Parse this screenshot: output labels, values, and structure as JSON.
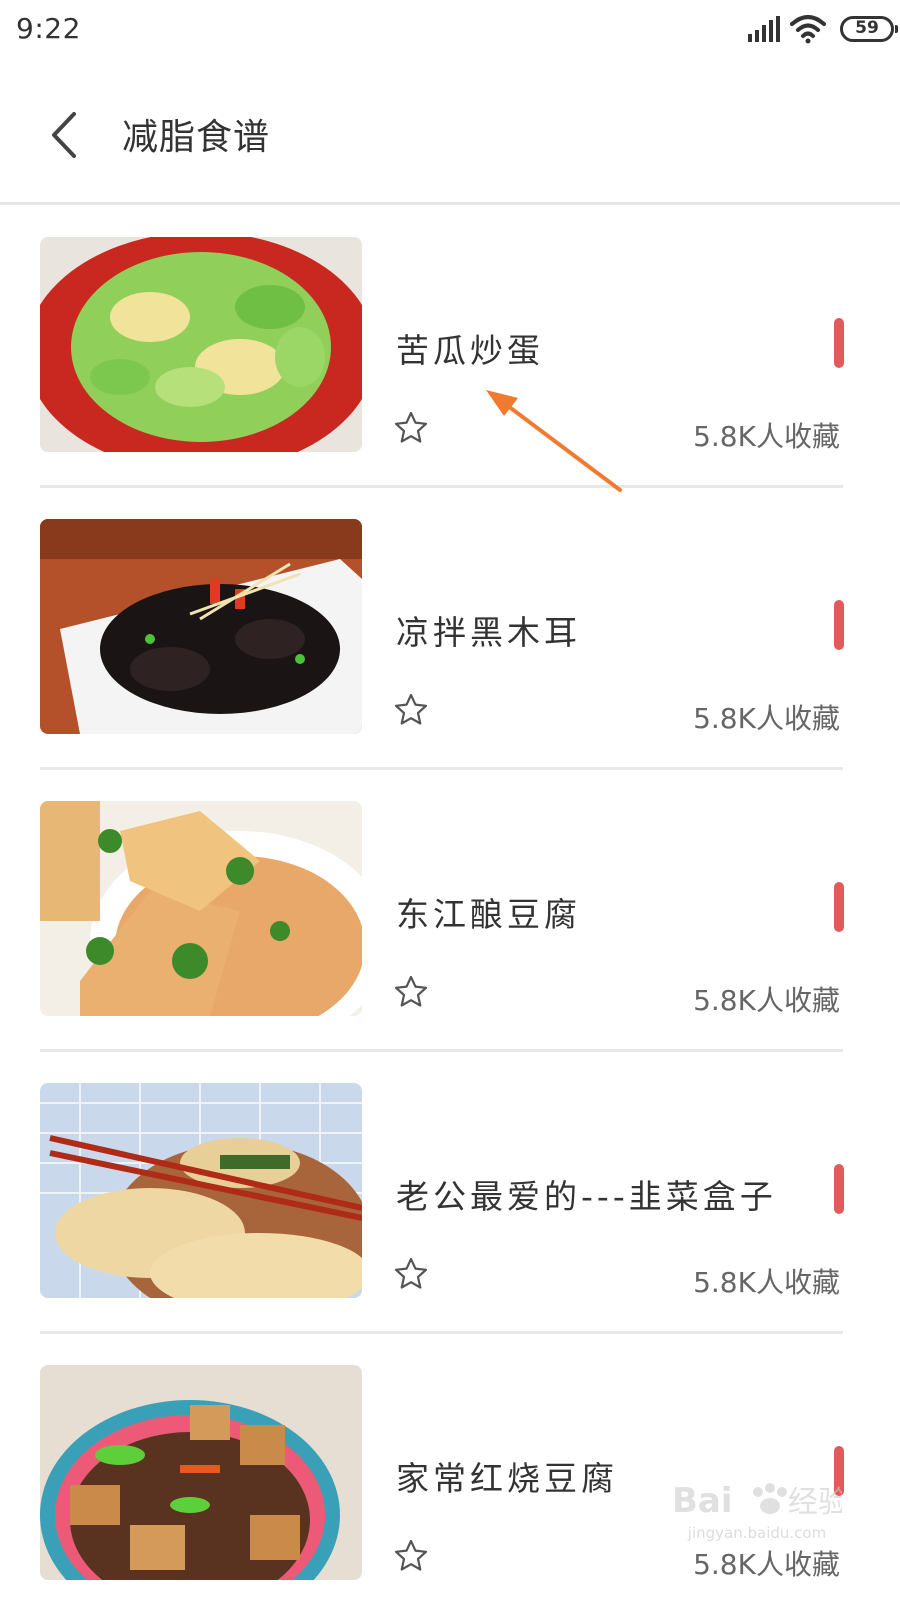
{
  "status_bar": {
    "time": "9:22",
    "battery": "59",
    "icons": [
      "signal-icon",
      "wifi-icon",
      "battery-icon"
    ]
  },
  "header": {
    "back_icon": "chevron-left-icon",
    "title": "减脂食谱"
  },
  "recipes": [
    {
      "title": "苦瓜炒蛋",
      "favorites": "5.8K人收藏",
      "image": "bitter-melon-egg-photo"
    },
    {
      "title": "凉拌黑木耳",
      "favorites": "5.8K人收藏",
      "image": "black-fungus-salad-photo"
    },
    {
      "title": "东江酿豆腐",
      "favorites": "5.8K人收藏",
      "image": "stuffed-tofu-photo"
    },
    {
      "title": "老公最爱的---韭菜盒子",
      "favorites": "5.8K人收藏",
      "image": "leek-pocket-photo"
    },
    {
      "title": "家常红烧豆腐",
      "favorites": "5.8K人收藏",
      "image": "braised-tofu-photo"
    }
  ],
  "annotation": {
    "type": "arrow",
    "color": "#f07a30"
  },
  "watermark": {
    "brand": "Bai经验",
    "url": "jingyan.baidu.com"
  },
  "colors": {
    "accent_marker": "#e25a5a",
    "divider": "#e8e8e8",
    "arrow": "#f07a30"
  }
}
